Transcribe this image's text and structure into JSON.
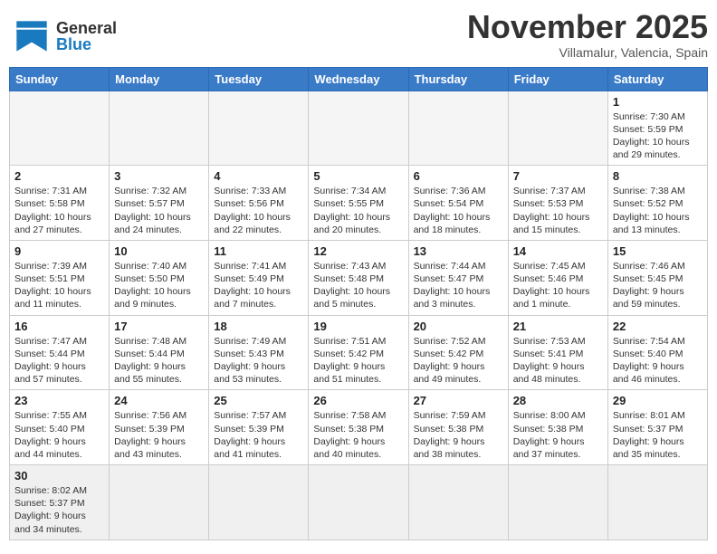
{
  "header": {
    "logo_general": "General",
    "logo_blue": "Blue",
    "month_title": "November 2025",
    "location": "Villamalur, Valencia, Spain"
  },
  "weekdays": [
    "Sunday",
    "Monday",
    "Tuesday",
    "Wednesday",
    "Thursday",
    "Friday",
    "Saturday"
  ],
  "weeks": [
    [
      {
        "day": "",
        "info": ""
      },
      {
        "day": "",
        "info": ""
      },
      {
        "day": "",
        "info": ""
      },
      {
        "day": "",
        "info": ""
      },
      {
        "day": "",
        "info": ""
      },
      {
        "day": "",
        "info": ""
      },
      {
        "day": "1",
        "info": "Sunrise: 7:30 AM\nSunset: 5:59 PM\nDaylight: 10 hours\nand 29 minutes."
      }
    ],
    [
      {
        "day": "2",
        "info": "Sunrise: 7:31 AM\nSunset: 5:58 PM\nDaylight: 10 hours\nand 27 minutes."
      },
      {
        "day": "3",
        "info": "Sunrise: 7:32 AM\nSunset: 5:57 PM\nDaylight: 10 hours\nand 24 minutes."
      },
      {
        "day": "4",
        "info": "Sunrise: 7:33 AM\nSunset: 5:56 PM\nDaylight: 10 hours\nand 22 minutes."
      },
      {
        "day": "5",
        "info": "Sunrise: 7:34 AM\nSunset: 5:55 PM\nDaylight: 10 hours\nand 20 minutes."
      },
      {
        "day": "6",
        "info": "Sunrise: 7:36 AM\nSunset: 5:54 PM\nDaylight: 10 hours\nand 18 minutes."
      },
      {
        "day": "7",
        "info": "Sunrise: 7:37 AM\nSunset: 5:53 PM\nDaylight: 10 hours\nand 15 minutes."
      },
      {
        "day": "8",
        "info": "Sunrise: 7:38 AM\nSunset: 5:52 PM\nDaylight: 10 hours\nand 13 minutes."
      }
    ],
    [
      {
        "day": "9",
        "info": "Sunrise: 7:39 AM\nSunset: 5:51 PM\nDaylight: 10 hours\nand 11 minutes."
      },
      {
        "day": "10",
        "info": "Sunrise: 7:40 AM\nSunset: 5:50 PM\nDaylight: 10 hours\nand 9 minutes."
      },
      {
        "day": "11",
        "info": "Sunrise: 7:41 AM\nSunset: 5:49 PM\nDaylight: 10 hours\nand 7 minutes."
      },
      {
        "day": "12",
        "info": "Sunrise: 7:43 AM\nSunset: 5:48 PM\nDaylight: 10 hours\nand 5 minutes."
      },
      {
        "day": "13",
        "info": "Sunrise: 7:44 AM\nSunset: 5:47 PM\nDaylight: 10 hours\nand 3 minutes."
      },
      {
        "day": "14",
        "info": "Sunrise: 7:45 AM\nSunset: 5:46 PM\nDaylight: 10 hours\nand 1 minute."
      },
      {
        "day": "15",
        "info": "Sunrise: 7:46 AM\nSunset: 5:45 PM\nDaylight: 9 hours\nand 59 minutes."
      }
    ],
    [
      {
        "day": "16",
        "info": "Sunrise: 7:47 AM\nSunset: 5:44 PM\nDaylight: 9 hours\nand 57 minutes."
      },
      {
        "day": "17",
        "info": "Sunrise: 7:48 AM\nSunset: 5:44 PM\nDaylight: 9 hours\nand 55 minutes."
      },
      {
        "day": "18",
        "info": "Sunrise: 7:49 AM\nSunset: 5:43 PM\nDaylight: 9 hours\nand 53 minutes."
      },
      {
        "day": "19",
        "info": "Sunrise: 7:51 AM\nSunset: 5:42 PM\nDaylight: 9 hours\nand 51 minutes."
      },
      {
        "day": "20",
        "info": "Sunrise: 7:52 AM\nSunset: 5:42 PM\nDaylight: 9 hours\nand 49 minutes."
      },
      {
        "day": "21",
        "info": "Sunrise: 7:53 AM\nSunset: 5:41 PM\nDaylight: 9 hours\nand 48 minutes."
      },
      {
        "day": "22",
        "info": "Sunrise: 7:54 AM\nSunset: 5:40 PM\nDaylight: 9 hours\nand 46 minutes."
      }
    ],
    [
      {
        "day": "23",
        "info": "Sunrise: 7:55 AM\nSunset: 5:40 PM\nDaylight: 9 hours\nand 44 minutes."
      },
      {
        "day": "24",
        "info": "Sunrise: 7:56 AM\nSunset: 5:39 PM\nDaylight: 9 hours\nand 43 minutes."
      },
      {
        "day": "25",
        "info": "Sunrise: 7:57 AM\nSunset: 5:39 PM\nDaylight: 9 hours\nand 41 minutes."
      },
      {
        "day": "26",
        "info": "Sunrise: 7:58 AM\nSunset: 5:38 PM\nDaylight: 9 hours\nand 40 minutes."
      },
      {
        "day": "27",
        "info": "Sunrise: 7:59 AM\nSunset: 5:38 PM\nDaylight: 9 hours\nand 38 minutes."
      },
      {
        "day": "28",
        "info": "Sunrise: 8:00 AM\nSunset: 5:38 PM\nDaylight: 9 hours\nand 37 minutes."
      },
      {
        "day": "29",
        "info": "Sunrise: 8:01 AM\nSunset: 5:37 PM\nDaylight: 9 hours\nand 35 minutes."
      }
    ],
    [
      {
        "day": "30",
        "info": "Sunrise: 8:02 AM\nSunset: 5:37 PM\nDaylight: 9 hours\nand 34 minutes."
      },
      {
        "day": "",
        "info": ""
      },
      {
        "day": "",
        "info": ""
      },
      {
        "day": "",
        "info": ""
      },
      {
        "day": "",
        "info": ""
      },
      {
        "day": "",
        "info": ""
      },
      {
        "day": "",
        "info": ""
      }
    ]
  ]
}
